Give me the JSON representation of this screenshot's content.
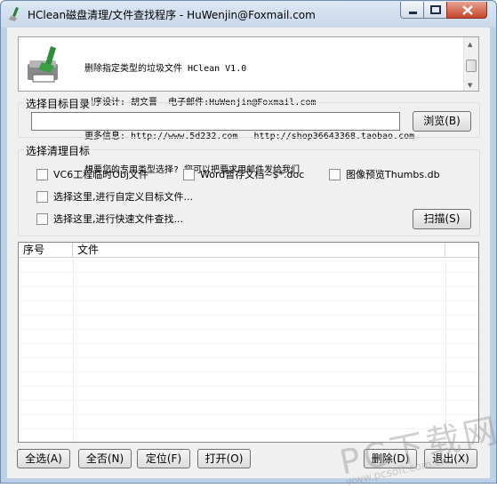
{
  "window": {
    "title": "HClean磁盘清理/文件查找程序 - HuWenjin@Foxmail.com",
    "icon": "broom-icon"
  },
  "info": {
    "lines": [
      "删除指定类型的垃圾文件 HClean V1.0",
      "程序设计: 胡文晋  电子邮件:HuWenjin@Foxmail.com",
      "更多信息: http://www.5d232.com   http://shop36643368.taobao.com",
      "想要您的专用类型选择? 您可以把要求用邮件发给我们"
    ]
  },
  "target_dir": {
    "legend": "选择目标目录",
    "value": "",
    "browse_label": "浏览(B)"
  },
  "cleanup": {
    "legend": "选择清理目标",
    "options": [
      {
        "label": "VC6工程临时Obj文件",
        "checked": false
      },
      {
        "label": "Word暂存文档~$*.doc",
        "checked": false
      },
      {
        "label": "图像预览Thumbs.db",
        "checked": false
      },
      {
        "label": "选择这里,进行自定义目标文件...",
        "checked": false
      },
      {
        "label": "选择这里,进行快速文件查找...",
        "checked": false
      }
    ],
    "scan_label": "扫描(S)"
  },
  "file_list": {
    "columns": [
      "序号",
      "文件"
    ],
    "rows": []
  },
  "buttons": {
    "select_all": "全选(A)",
    "select_none": "全否(N)",
    "locate": "定位(F)",
    "open": "打开(O)",
    "delete": "删除(D)",
    "exit": "退出(X)"
  },
  "watermark": {
    "text": "PC下载网",
    "sub": "www.pcsoft.com.cn"
  },
  "colors": {
    "title_bar": "#c9d8eb",
    "dialog_bg": "#f0f0f0",
    "close_button": "#c7442b"
  }
}
